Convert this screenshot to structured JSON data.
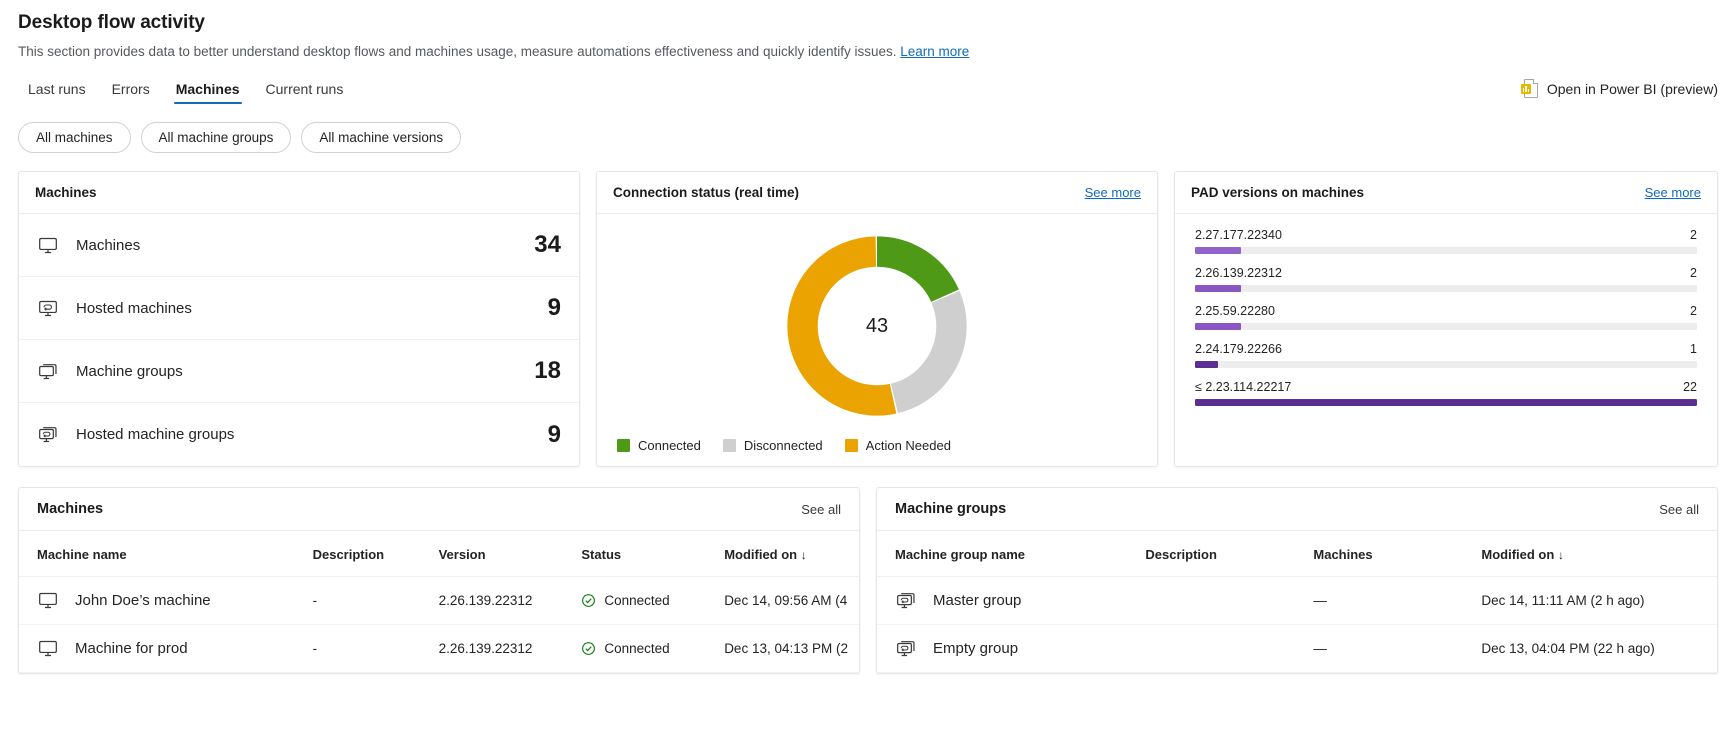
{
  "header": {
    "title": "Desktop flow activity",
    "description": "This section provides data to better understand desktop flows and machines usage, measure automations effectiveness and quickly identify issues.",
    "learn_more": "Learn more",
    "power_bi_label": "Open in Power BI (preview)"
  },
  "tabs": [
    {
      "label": "Last runs",
      "active": false
    },
    {
      "label": "Errors",
      "active": false
    },
    {
      "label": "Machines",
      "active": true
    },
    {
      "label": "Current runs",
      "active": false
    }
  ],
  "filters": [
    {
      "label": "All machines"
    },
    {
      "label": "All machine groups"
    },
    {
      "label": "All machine versions"
    }
  ],
  "machines_card": {
    "title": "Machines",
    "rows": [
      {
        "icon": "monitor-icon",
        "label": "Machines",
        "value": "34"
      },
      {
        "icon": "hosted-monitor-icon",
        "label": "Hosted machines",
        "value": "9"
      },
      {
        "icon": "monitor-group-icon",
        "label": "Machine groups",
        "value": "18"
      },
      {
        "icon": "hosted-monitor-group-icon",
        "label": "Hosted machine groups",
        "value": "9"
      }
    ]
  },
  "connection_card": {
    "title": "Connection status (real time)",
    "see_more": "See more",
    "center_value": "43"
  },
  "pad_card": {
    "title": "PAD versions on machines",
    "see_more": "See more"
  },
  "machines_table": {
    "title": "Machines",
    "see_all": "See all",
    "columns": [
      "Machine name",
      "Description",
      "Version",
      "Status",
      "Modified on"
    ],
    "sort_column": "Modified on",
    "sort_arrow": "↓",
    "rows": [
      {
        "icon": "monitor-icon",
        "name": "John Doe’s machine",
        "description": "-",
        "version": "2.26.139.22312",
        "status": "Connected",
        "modified_on": "Dec 14, 09:56 AM (4"
      },
      {
        "icon": "monitor-icon",
        "name": "Machine for prod",
        "description": "-",
        "version": "2.26.139.22312",
        "status": "Connected",
        "modified_on": "Dec 13, 04:13 PM (2"
      }
    ]
  },
  "machine_groups_table": {
    "title": "Machine groups",
    "see_all": "See all",
    "columns": [
      "Machine group name",
      "Description",
      "Machines",
      "Modified on"
    ],
    "sort_column": "Modified on",
    "sort_arrow": "↓",
    "rows": [
      {
        "icon": "monitor-group-icon",
        "name": "Master group",
        "description": "",
        "machines": "—",
        "modified_on": "Dec 14, 11:11 AM (2 h ago)"
      },
      {
        "icon": "monitor-group-icon",
        "name": "Empty group",
        "description": "",
        "machines": "—",
        "modified_on": "Dec 13, 04:04 PM (22 h ago)"
      }
    ]
  },
  "colors": {
    "connected": "#4e9a16",
    "disconnected": "#cfcfcf",
    "action_needed": "#eaa300",
    "link": "#0f6cbd",
    "bar_light": "#9064c8",
    "bar_mid": "#8a56c2",
    "bar_dark": "#5c2e91",
    "bar_track": "#ededed"
  },
  "chart_data": [
    {
      "type": "pie",
      "title": "Connection status (real time)",
      "subtitle": "",
      "center_label": "43",
      "donut": true,
      "legend_position": "bottom-left",
      "categories": [
        "Connected",
        "Disconnected",
        "Action Needed"
      ],
      "values": [
        8,
        12,
        23
      ],
      "colors": [
        "#4e9a16",
        "#cfcfcf",
        "#eaa300"
      ],
      "total": 43
    },
    {
      "type": "bar",
      "title": "PAD versions on machines",
      "orientation": "horizontal",
      "xlabel": "",
      "ylabel": "",
      "grid": false,
      "legend_position": "none",
      "categories": [
        "2.27.177.22340",
        "2.26.139.22312",
        "2.25.59.22280",
        "2.24.179.22266",
        "≤ 2.23.114.22217"
      ],
      "values": [
        2,
        2,
        2,
        1,
        22
      ],
      "value_labels": [
        "2",
        "2",
        "2",
        "1",
        "22"
      ],
      "max_value": 22,
      "bar_colors": [
        "#9064c8",
        "#8a56c2",
        "#8a56c2",
        "#5c2e91",
        "#5c2e91"
      ],
      "track_color": "#ededed"
    }
  ]
}
